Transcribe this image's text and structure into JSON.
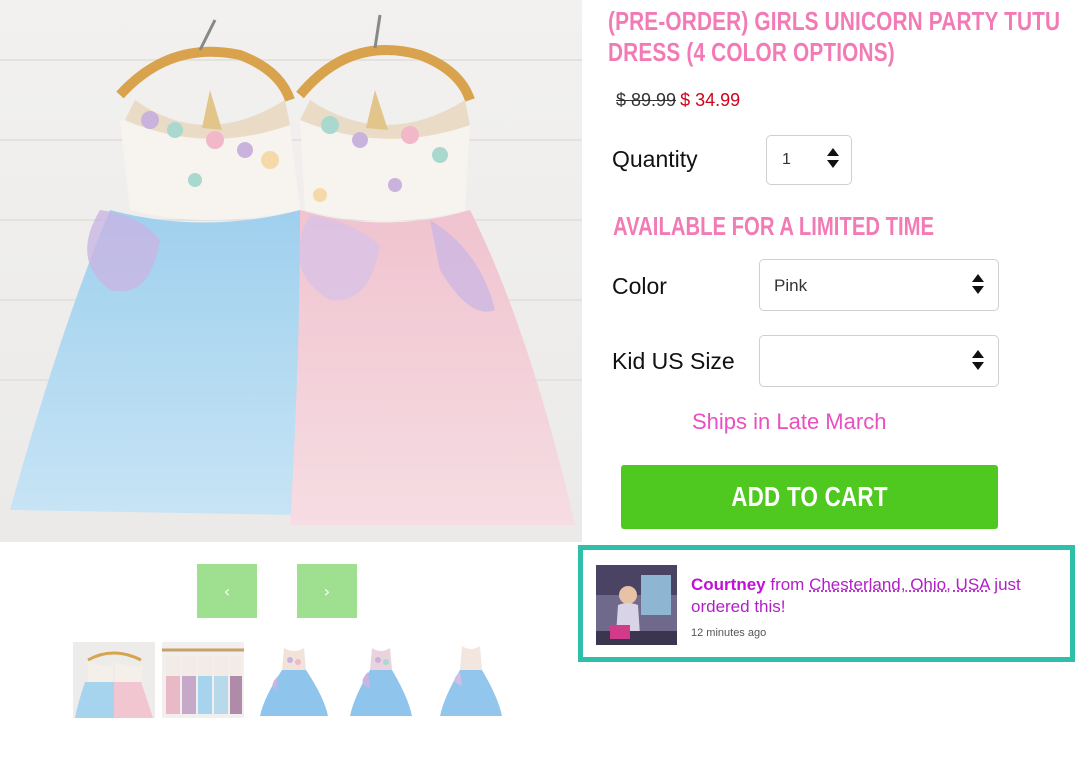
{
  "product": {
    "title": "(PRE-ORDER) GIRLS UNICORN PARTY TUTU DRESS (4 COLOR OPTIONS)",
    "price_original": "$ 89.99",
    "price_sale": "$ 34.99",
    "quantity_label": "Quantity",
    "quantity_value": "1",
    "availability": "AVAILABLE FOR A LIMITED TIME",
    "color_label": "Color",
    "color_value": "Pink",
    "size_label": "Kid US Size",
    "size_value": "",
    "ships_text": "Ships in Late March",
    "add_to_cart_label": "ADD TO CART"
  },
  "gallery": {
    "prev_label": "‹",
    "next_label": "›",
    "thumbnails": [
      "dresses-pair",
      "dresses-rack",
      "blue-dress-front",
      "blue-dress-side",
      "blue-dress-back"
    ]
  },
  "notification": {
    "name": "Courtney",
    "from_text": " from ",
    "location": "Chesterland, Ohio, USA",
    "action": " just ordered this!",
    "time": "12 minutes ago"
  },
  "colors": {
    "title_pink": "#f27bb6",
    "sale_red": "#d0021b",
    "ships_pink": "#e94fc1",
    "cart_green": "#4fc81f",
    "nav_green": "#9ee08f",
    "popup_border": "#2ebfa8"
  }
}
